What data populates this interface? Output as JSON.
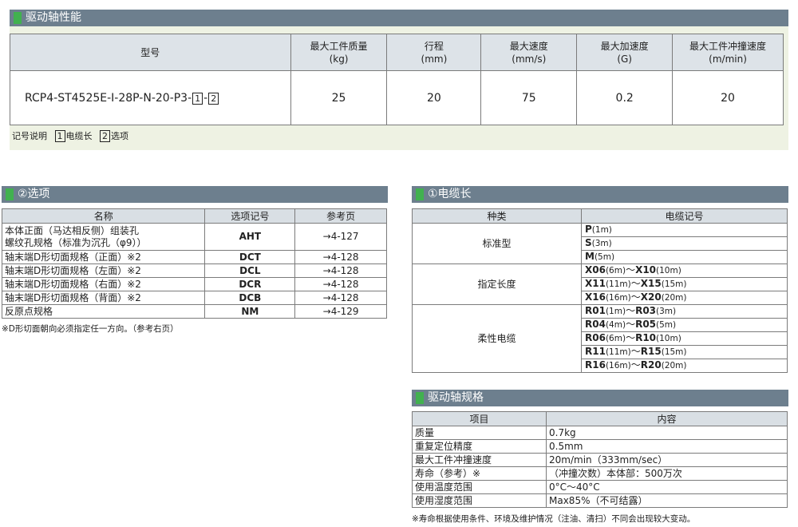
{
  "section1": {
    "title": "驱动轴性能",
    "headers": [
      "型号",
      "最大工件质量",
      "(kg)",
      "行程",
      "(mm)",
      "最大速度",
      "(mm/s)",
      "最大加速度",
      "(G)",
      "最大工件冲撞速度",
      "(m/min)"
    ],
    "model_prefix": "RCP4-ST4525E-I-28P-N-20-P3-",
    "box1": "1",
    "sep": "-",
    "box2": "2",
    "values": [
      "25",
      "20",
      "75",
      "0.2",
      "20"
    ],
    "legend_label": "记号说明",
    "legend_1": "电缆长",
    "legend_2": "选项"
  },
  "options": {
    "title": "②选项",
    "headers": [
      "名称",
      "选项记号",
      "参考页"
    ],
    "row0_name_line1": "本体正面（马达相反侧）组装孔",
    "row0_name_line2": "螺纹孔规格（标准为沉孔（φ9））",
    "rows": [
      {
        "name": "",
        "code": "AHT",
        "ref": "→4-127"
      },
      {
        "name": "轴末端D形切面规格（正面）※2",
        "code": "DCT",
        "ref": "→4-128"
      },
      {
        "name": "轴末端D形切面规格（左面）※2",
        "code": "DCL",
        "ref": "→4-128"
      },
      {
        "name": "轴末端D形切面规格（右面）※2",
        "code": "DCR",
        "ref": "→4-128"
      },
      {
        "name": "轴末端D形切面规格（背面）※2",
        "code": "DCB",
        "ref": "→4-128"
      },
      {
        "name": "反原点规格",
        "code": "NM",
        "ref": "→4-129"
      }
    ],
    "note": "※D形切面朝向必须指定任一方向。（参考右页）"
  },
  "cable": {
    "title": "①电缆长",
    "headers": [
      "种类",
      "电缆记号"
    ],
    "kinds": [
      "标准型",
      "指定长度",
      "柔性电缆"
    ],
    "standard": [
      {
        "code": "P",
        "len": "(1m)"
      },
      {
        "code": "S",
        "len": "(3m)"
      },
      {
        "code": "M",
        "len": "(5m)"
      }
    ],
    "ranges": [
      {
        "a": "X06",
        "al": "(6m)",
        "t": "～",
        "b": "X10",
        "bl": "(10m)"
      },
      {
        "a": "X11",
        "al": "(11m)",
        "t": "～",
        "b": "X15",
        "bl": "(15m)"
      },
      {
        "a": "X16",
        "al": "(16m)",
        "t": "～",
        "b": "X20",
        "bl": "(20m)"
      },
      {
        "a": "R01",
        "al": "(1m)",
        "t": "～",
        "b": "R03",
        "bl": "(3m)"
      },
      {
        "a": "R04",
        "al": "(4m)",
        "t": "～",
        "b": "R05",
        "bl": "(5m)"
      },
      {
        "a": "R06",
        "al": "(6m)",
        "t": "～",
        "b": "R10",
        "bl": "(10m)"
      },
      {
        "a": "R11",
        "al": "(11m)",
        "t": "～",
        "b": "R15",
        "bl": "(15m)"
      },
      {
        "a": "R16",
        "al": "(16m)",
        "t": "～",
        "b": "R20",
        "bl": "(20m)"
      }
    ]
  },
  "axis": {
    "title": "驱动轴规格",
    "headers": [
      "项目",
      "内容"
    ],
    "rows": [
      {
        "k": "质量",
        "v": "0.7kg"
      },
      {
        "k": "重复定位精度",
        "v": "0.5mm"
      },
      {
        "k": "最大工件冲撞速度",
        "v": "20m/min（333mm/sec）"
      },
      {
        "k": "寿命（参考）※",
        "v": "（冲撞次数）本体部：500万次"
      },
      {
        "k": "使用温度范围",
        "v": "0°C～40°C"
      },
      {
        "k": "使用湿度范围",
        "v": "Max85%（不可结露）"
      }
    ],
    "note": "※寿命根据使用条件、环境及维护情况（注油、清扫）不同会出现较大变动。"
  }
}
